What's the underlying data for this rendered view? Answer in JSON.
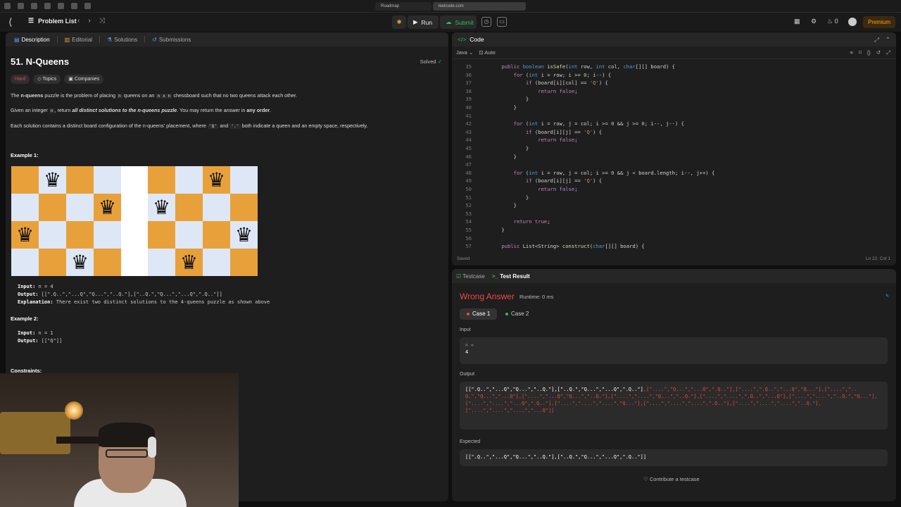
{
  "browser": {
    "tab1": "Roadmap",
    "tab2": "leetcode.com"
  },
  "topbar": {
    "problem_list": "Problem List",
    "run": "Run",
    "submit": "Submit",
    "points": "0",
    "premium": "Premium"
  },
  "left": {
    "tabs": [
      "Description",
      "Editorial",
      "Solutions",
      "Submissions"
    ],
    "title": "51. N-Queens",
    "solved": "Solved",
    "chips": {
      "difficulty": "Hard",
      "topics": "Topics",
      "companies": "Companies"
    },
    "desc1_a": "The ",
    "desc1_b": "n-queens",
    "desc1_c": " puzzle is the problem of placing ",
    "desc1_d": "n",
    "desc1_e": " queens on an ",
    "desc1_f": "n x n",
    "desc1_g": " chessboard such that no two queens attack each other.",
    "desc2_a": "Given an integer ",
    "desc2_b": "n",
    "desc2_c": ", return ",
    "desc2_d": "all distinct solutions to the n-queens puzzle",
    "desc2_e": ". You may return the answer in ",
    "desc2_f": "any order",
    "desc2_g": ".",
    "desc3_a": "Each solution contains a distinct board configuration of the n-queens' placement, where ",
    "desc3_b": "'Q'",
    "desc3_c": " and ",
    "desc3_d": "'.'",
    "desc3_e": " both indicate a queen and an empty space, respectively.",
    "example1": "Example 1:",
    "ex1_input_label": "Input:",
    "ex1_input": " n = 4",
    "ex1_output_label": "Output:",
    "ex1_output": " [[\".Q..\",\"...Q\",\"Q...\",\"..Q.\"],[\"..Q.\",\"Q...\",\"...Q\",\".Q..\"]]",
    "ex1_expl_label": "Explanation:",
    "ex1_expl": " There exist two distinct solutions to the 4-queens puzzle as shown above",
    "example2": "Example 2:",
    "ex2_input_label": "Input:",
    "ex2_input": " n = 1",
    "ex2_output_label": "Output:",
    "ex2_output": " [[\"Q\"]]",
    "constraints": "Constraints:"
  },
  "code": {
    "title": "Code",
    "lang": "Java",
    "auto": "Auto",
    "lines": [
      {
        "n": "35",
        "t": "    public boolean isSafe(int row, int col, char[][] board) {"
      },
      {
        "n": "36",
        "t": "        for (int i = row; i >= 0; i--) {"
      },
      {
        "n": "37",
        "t": "            if (board[i][col] == 'Q') {"
      },
      {
        "n": "38",
        "t": "                return false;"
      },
      {
        "n": "39",
        "t": "            }"
      },
      {
        "n": "40",
        "t": "        }"
      },
      {
        "n": "41",
        "t": ""
      },
      {
        "n": "42",
        "t": "        for (int i = row, j = col; i >= 0 && j >= 0; i--, j--) {"
      },
      {
        "n": "43",
        "t": "            if (board[i][j] == 'Q') {"
      },
      {
        "n": "44",
        "t": "                return false;"
      },
      {
        "n": "45",
        "t": "            }"
      },
      {
        "n": "46",
        "t": "        }"
      },
      {
        "n": "47",
        "t": ""
      },
      {
        "n": "48",
        "t": "        for (int i = row, j = col; i >= 0 && j < board.length; i--, j++) {"
      },
      {
        "n": "49",
        "t": "            if (board[i][j] == 'Q') {"
      },
      {
        "n": "50",
        "t": "                return false;"
      },
      {
        "n": "51",
        "t": "            }"
      },
      {
        "n": "52",
        "t": "        }"
      },
      {
        "n": "53",
        "t": ""
      },
      {
        "n": "54",
        "t": "        return true;"
      },
      {
        "n": "55",
        "t": "    }"
      },
      {
        "n": "56",
        "t": ""
      },
      {
        "n": "57",
        "t": "    public List<String> construct(char[][] board) {"
      }
    ],
    "saved": "Saved",
    "cursor": "Ln 22, Col 1"
  },
  "result": {
    "tabs": [
      "Testcase",
      "Test Result"
    ],
    "verdict": "Wrong Answer",
    "runtime": "Runtime: 0 ms",
    "case1": "Case 1",
    "case2": "Case 2",
    "input_label": "Input",
    "n_label": "n =",
    "n_value": "4",
    "output_label": "Output",
    "output_ok": "[[\".Q..\",\"...Q\",\"Q...\",\"..Q.\"],[\"..Q.\",\"Q...\",\"...Q\",\".Q..\"]",
    "output_bad": ",[\"....\",\"Q...\",\"...Q\",\".Q..\"],[\"....\",\".Q..\",\"...Q\",\"Q...\"],[\"....\",\"..Q.\",\"Q...\",\"...Q\"],[\"....\",\"...Q\",\"Q...\",\"..Q.\"],[\"....\",\"....\",\"Q...\",\"..Q.\"],[\"....\",\"....\",\".Q..\",\"...Q\"],[\"....\",\"....\",\"..Q.\",\"Q...\"],[\"....\",\"....\",\"...Q\",\".Q..\"],[\"....\",\"....\",\"....\",\"Q...\"],[\"....\",\"....\",\"....\",\".Q..\"],[\"....\",\"....\",\"....\",\"..Q.\"],[\"....\",\"....\",\"....\",\"...Q\"]]",
    "expected_label": "Expected",
    "expected": "[[\".Q..\",\"...Q\",\"Q...\",\"..Q.\"],[\"..Q.\",\"Q...\",\"...Q\",\".Q..\"]]",
    "contribute": "Contribute a testcase"
  },
  "boards": {
    "queen": "♛"
  },
  "colors": {
    "accent_orange": "#e8a13a",
    "light_square": "#dde7f5",
    "wrong": "#ef4743",
    "green": "#2cbb5d"
  }
}
